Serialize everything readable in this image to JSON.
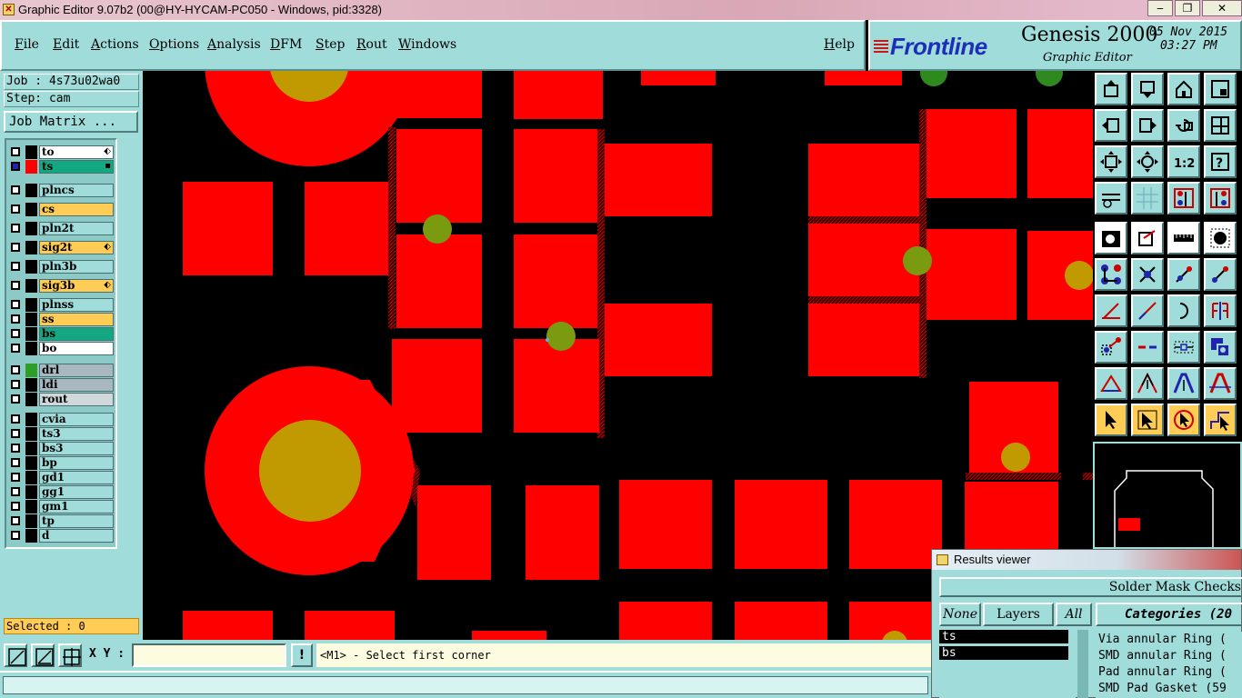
{
  "window": {
    "title": "Graphic Editor 9.07b2 (00@HY-HYCAM-PC050 - Windows, pid:3328)",
    "minimize": "‒",
    "maximize": "❐",
    "close": "✕"
  },
  "menu": {
    "items": [
      "File",
      "Edit",
      "Actions",
      "Options",
      "Analysis",
      "DFM",
      "Step",
      "Rout",
      "Windows"
    ],
    "help": "Help"
  },
  "logo": {
    "brand": "Frontline",
    "product": "Genesis 2000",
    "subtitle": "Graphic Editor",
    "date": "05 Nov 2015",
    "time": "03:27 PM"
  },
  "job": {
    "job_label": "Job : 4s73u02wa0",
    "step_label": "Step: cam",
    "matrix_button": "Job Matrix ..."
  },
  "layers": [
    {
      "name": "to",
      "bg": "#ffffff",
      "swatch": "#000000",
      "mark": "⬖"
    },
    {
      "name": "ts",
      "bg": "#14a882",
      "swatch": "#ff0000",
      "mark": "▪",
      "checked": true
    },
    {
      "name": "plncs",
      "bg": "#9fdcda",
      "swatch": "#000000"
    },
    {
      "name": "cs",
      "bg": "#ffcc55",
      "swatch": "#000000"
    },
    {
      "name": "pln2t",
      "bg": "#9fdcda",
      "swatch": "#000000"
    },
    {
      "name": "sig2t",
      "bg": "#ffcc55",
      "swatch": "#000000",
      "mark": "⬖"
    },
    {
      "name": "pln3b",
      "bg": "#9fdcda",
      "swatch": "#000000"
    },
    {
      "name": "sig3b",
      "bg": "#ffcc55",
      "swatch": "#000000",
      "mark": "⬖"
    },
    {
      "name": "plnss",
      "bg": "#9fdcda",
      "swatch": "#000000"
    },
    {
      "name": "ss",
      "bg": "#ffcc55",
      "swatch": "#000000"
    },
    {
      "name": "bs",
      "bg": "#14a882",
      "swatch": "#000000"
    },
    {
      "name": "bo",
      "bg": "#ffffff",
      "swatch": "#000000"
    },
    {
      "name": "drl",
      "bg": "#a8b8c0",
      "swatch": "#2e9e26"
    },
    {
      "name": "ldi",
      "bg": "#a8b8c0",
      "swatch": "#000000"
    },
    {
      "name": "rout",
      "bg": "#d0d8dc",
      "swatch": "#000000"
    },
    {
      "name": "cvia",
      "bg": "#9fdcda",
      "swatch": "#000000"
    },
    {
      "name": "ts3",
      "bg": "#9fdcda",
      "swatch": "#000000"
    },
    {
      "name": "bs3",
      "bg": "#9fdcda",
      "swatch": "#000000"
    },
    {
      "name": "bp",
      "bg": "#9fdcda",
      "swatch": "#000000"
    },
    {
      "name": "gd1",
      "bg": "#9fdcda",
      "swatch": "#000000"
    },
    {
      "name": "gg1",
      "bg": "#9fdcda",
      "swatch": "#000000"
    },
    {
      "name": "gm1",
      "bg": "#9fdcda",
      "swatch": "#000000"
    },
    {
      "name": "tp",
      "bg": "#9fdcda",
      "swatch": "#000000"
    },
    {
      "name": "d",
      "bg": "#9fdcda",
      "swatch": "#000000"
    }
  ],
  "selected_label": "Selected : 0",
  "bottom": {
    "xy_label": "X Y :",
    "xy_value": "",
    "bang": "!",
    "prompt": "<M1> - Select first corner"
  },
  "results": {
    "title": "Results viewer",
    "heading": "Solder Mask Checks",
    "none_button": "None",
    "layers_button": "Layers",
    "all_button": "All",
    "categories_label": "Categories (20",
    "layer_items": [
      "ts",
      "bs"
    ],
    "category_items": [
      "Via annular Ring (",
      "SMD annular Ring (",
      "Pad annular Ring (",
      "SMD Pad Gasket (59"
    ]
  },
  "colors": {
    "panel": "#9fdcda",
    "pad": "#ff0000",
    "drill": "#c09a00",
    "via": "#7a9a10"
  }
}
